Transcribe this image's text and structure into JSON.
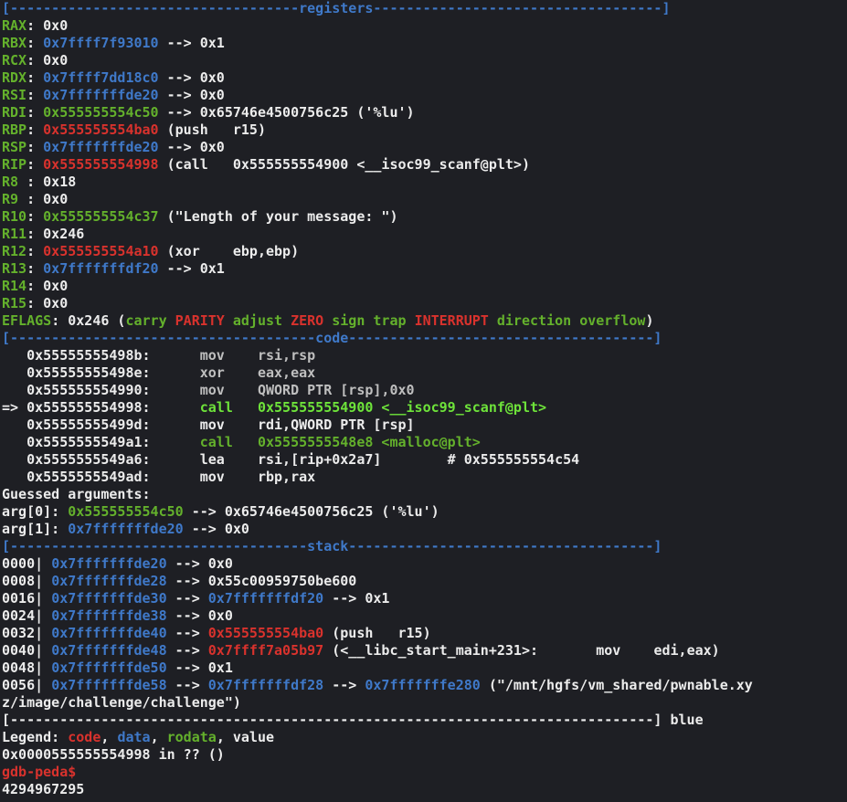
{
  "separators": {
    "registers": "[-----------------------------------registers-----------------------------------]",
    "code": "[-------------------------------------code-------------------------------------]",
    "stack": "[------------------------------------stack-------------------------------------]",
    "end": "[------------------------------------------------------------------------------]",
    "end_label": "blue"
  },
  "registers": [
    {
      "name": "RAX",
      "sep": ": ",
      "value": "0x0",
      "value_color": "white",
      "rest": ""
    },
    {
      "name": "RBX",
      "sep": ": ",
      "value": "0x7ffff7f93010",
      "value_color": "blue",
      "rest": " --> 0x1"
    },
    {
      "name": "RCX",
      "sep": ": ",
      "value": "0x0",
      "value_color": "white",
      "rest": ""
    },
    {
      "name": "RDX",
      "sep": ": ",
      "value": "0x7ffff7dd18c0",
      "value_color": "blue",
      "rest": " --> 0x0"
    },
    {
      "name": "RSI",
      "sep": ": ",
      "value": "0x7fffffffde20",
      "value_color": "blue",
      "rest": " --> 0x0"
    },
    {
      "name": "RDI",
      "sep": ": ",
      "value": "0x555555554c50",
      "value_color": "green",
      "rest": " --> 0x65746e4500756c25 ('%lu')"
    },
    {
      "name": "RBP",
      "sep": ": ",
      "value": "0x555555554ba0",
      "value_color": "red",
      "rest": " (push   r15)"
    },
    {
      "name": "RSP",
      "sep": ": ",
      "value": "0x7fffffffde20",
      "value_color": "blue",
      "rest": " --> 0x0"
    },
    {
      "name": "RIP",
      "sep": ": ",
      "value": "0x555555554998",
      "value_color": "red",
      "rest": " (call   0x555555554900 <__isoc99_scanf@plt>)"
    },
    {
      "name": "R8",
      "sep": " : ",
      "value": "0x18",
      "value_color": "white",
      "rest": ""
    },
    {
      "name": "R9",
      "sep": " : ",
      "value": "0x0",
      "value_color": "white",
      "rest": ""
    },
    {
      "name": "R10",
      "sep": ": ",
      "value": "0x555555554c37",
      "value_color": "green",
      "rest": " (\"Length of your message: \")"
    },
    {
      "name": "R11",
      "sep": ": ",
      "value": "0x246",
      "value_color": "white",
      "rest": ""
    },
    {
      "name": "R12",
      "sep": ": ",
      "value": "0x555555554a10",
      "value_color": "red",
      "rest": " (xor    ebp,ebp)"
    },
    {
      "name": "R13",
      "sep": ": ",
      "value": "0x7fffffffdf20",
      "value_color": "blue",
      "rest": " --> 0x1"
    },
    {
      "name": "R14",
      "sep": ": ",
      "value": "0x0",
      "value_color": "white",
      "rest": ""
    },
    {
      "name": "R15",
      "sep": ": ",
      "value": "0x0",
      "value_color": "white",
      "rest": ""
    }
  ],
  "eflags": {
    "name": "EFLAGS",
    "value": "0x246",
    "flags": [
      {
        "text": "carry",
        "color": "green"
      },
      {
        "text": "PARITY",
        "color": "red"
      },
      {
        "text": "adjust",
        "color": "green"
      },
      {
        "text": "ZERO",
        "color": "red"
      },
      {
        "text": "sign",
        "color": "green"
      },
      {
        "text": "trap",
        "color": "green"
      },
      {
        "text": "INTERRUPT",
        "color": "red"
      },
      {
        "text": "direction",
        "color": "green"
      },
      {
        "text": "overflow",
        "color": "green"
      }
    ]
  },
  "code": [
    {
      "prefix": "   ",
      "addr": "0x55555555498b:",
      "op": "mov",
      "args": "rsi,rsp",
      "style": "dim"
    },
    {
      "prefix": "   ",
      "addr": "0x55555555498e:",
      "op": "xor",
      "args": "eax,eax",
      "style": "dim"
    },
    {
      "prefix": "   ",
      "addr": "0x555555554990:",
      "op": "mov",
      "args": "QWORD PTR [rsp],0x0",
      "style": "dim"
    },
    {
      "prefix": "=> ",
      "addr": "0x555555554998:",
      "op": "call",
      "args": "0x555555554900 <__isoc99_scanf@plt>",
      "style": "current"
    },
    {
      "prefix": "   ",
      "addr": "0x55555555499d:",
      "op": "mov",
      "args": "rdi,QWORD PTR [rsp]",
      "style": "normal"
    },
    {
      "prefix": "   ",
      "addr": "0x5555555549a1:",
      "op": "call",
      "args": "0x5555555548e8 <malloc@plt>",
      "style": "call"
    },
    {
      "prefix": "   ",
      "addr": "0x5555555549a6:",
      "op": "lea",
      "args": "rsi,[rip+0x2a7]        # 0x555555554c54",
      "style": "normal"
    },
    {
      "prefix": "   ",
      "addr": "0x5555555549ad:",
      "op": "mov",
      "args": "rbp,rax",
      "style": "normal"
    }
  ],
  "guessed": {
    "title": "Guessed arguments:",
    "args": [
      {
        "label": "arg[0]: ",
        "addr": "0x555555554c50",
        "rest": " --> 0x65746e4500756c25 ('%lu')"
      },
      {
        "label": "arg[1]: ",
        "addr": "0x7fffffffde20",
        "rest": " --> 0x0"
      }
    ]
  },
  "stack": [
    {
      "off": "0000|",
      "addr": "0x7fffffffde20",
      "parts": [
        {
          "t": " --> ",
          "c": "white"
        },
        {
          "t": "0x0",
          "c": "white"
        }
      ]
    },
    {
      "off": "0008|",
      "addr": "0x7fffffffde28",
      "parts": [
        {
          "t": " --> ",
          "c": "white"
        },
        {
          "t": "0x55c00959750be600",
          "c": "white"
        }
      ]
    },
    {
      "off": "0016|",
      "addr": "0x7fffffffde30",
      "parts": [
        {
          "t": " --> ",
          "c": "white"
        },
        {
          "t": "0x7fffffffdf20",
          "c": "blue"
        },
        {
          "t": " --> 0x1",
          "c": "white"
        }
      ]
    },
    {
      "off": "0024|",
      "addr": "0x7fffffffde38",
      "parts": [
        {
          "t": " --> ",
          "c": "white"
        },
        {
          "t": "0x0",
          "c": "white"
        }
      ]
    },
    {
      "off": "0032|",
      "addr": "0x7fffffffde40",
      "parts": [
        {
          "t": " --> ",
          "c": "white"
        },
        {
          "t": "0x555555554ba0",
          "c": "red"
        },
        {
          "t": " (push   r15)",
          "c": "white"
        }
      ]
    },
    {
      "off": "0040|",
      "addr": "0x7fffffffde48",
      "parts": [
        {
          "t": " --> ",
          "c": "white"
        },
        {
          "t": "0x7ffff7a05b97",
          "c": "red"
        },
        {
          "t": " (<__libc_start_main+231>:       mov    edi,eax)",
          "c": "white"
        }
      ]
    },
    {
      "off": "0048|",
      "addr": "0x7fffffffde50",
      "parts": [
        {
          "t": " --> ",
          "c": "white"
        },
        {
          "t": "0x1",
          "c": "white"
        }
      ]
    },
    {
      "off": "0056|",
      "addr": "0x7fffffffde58",
      "parts": [
        {
          "t": " --> ",
          "c": "white"
        },
        {
          "t": "0x7fffffffdf28",
          "c": "blue"
        },
        {
          "t": " --> ",
          "c": "white"
        },
        {
          "t": "0x7fffffffe280",
          "c": "blue"
        },
        {
          "t": " (\"/mnt/hgfs/vm_shared/pwnable.xy",
          "c": "white"
        }
      ]
    }
  ],
  "stack_wrap": "z/image/challenge/challenge\")",
  "legend": {
    "label": "Legend: ",
    "items": [
      {
        "text": "code",
        "color": "red"
      },
      {
        "text": "data",
        "color": "blue"
      },
      {
        "text": "rodata",
        "color": "green"
      },
      {
        "text": "value",
        "color": "white"
      }
    ]
  },
  "location": "0x0000555555554998 in ?? ()",
  "prompt": "gdb-peda$",
  "input": "4294967295",
  "colors": {
    "background": "#1e1f24",
    "text": "#ececec",
    "blue": "#3f79c9",
    "green": "#64b12c",
    "bright_green": "#6ee33a",
    "red": "#d9322d"
  }
}
